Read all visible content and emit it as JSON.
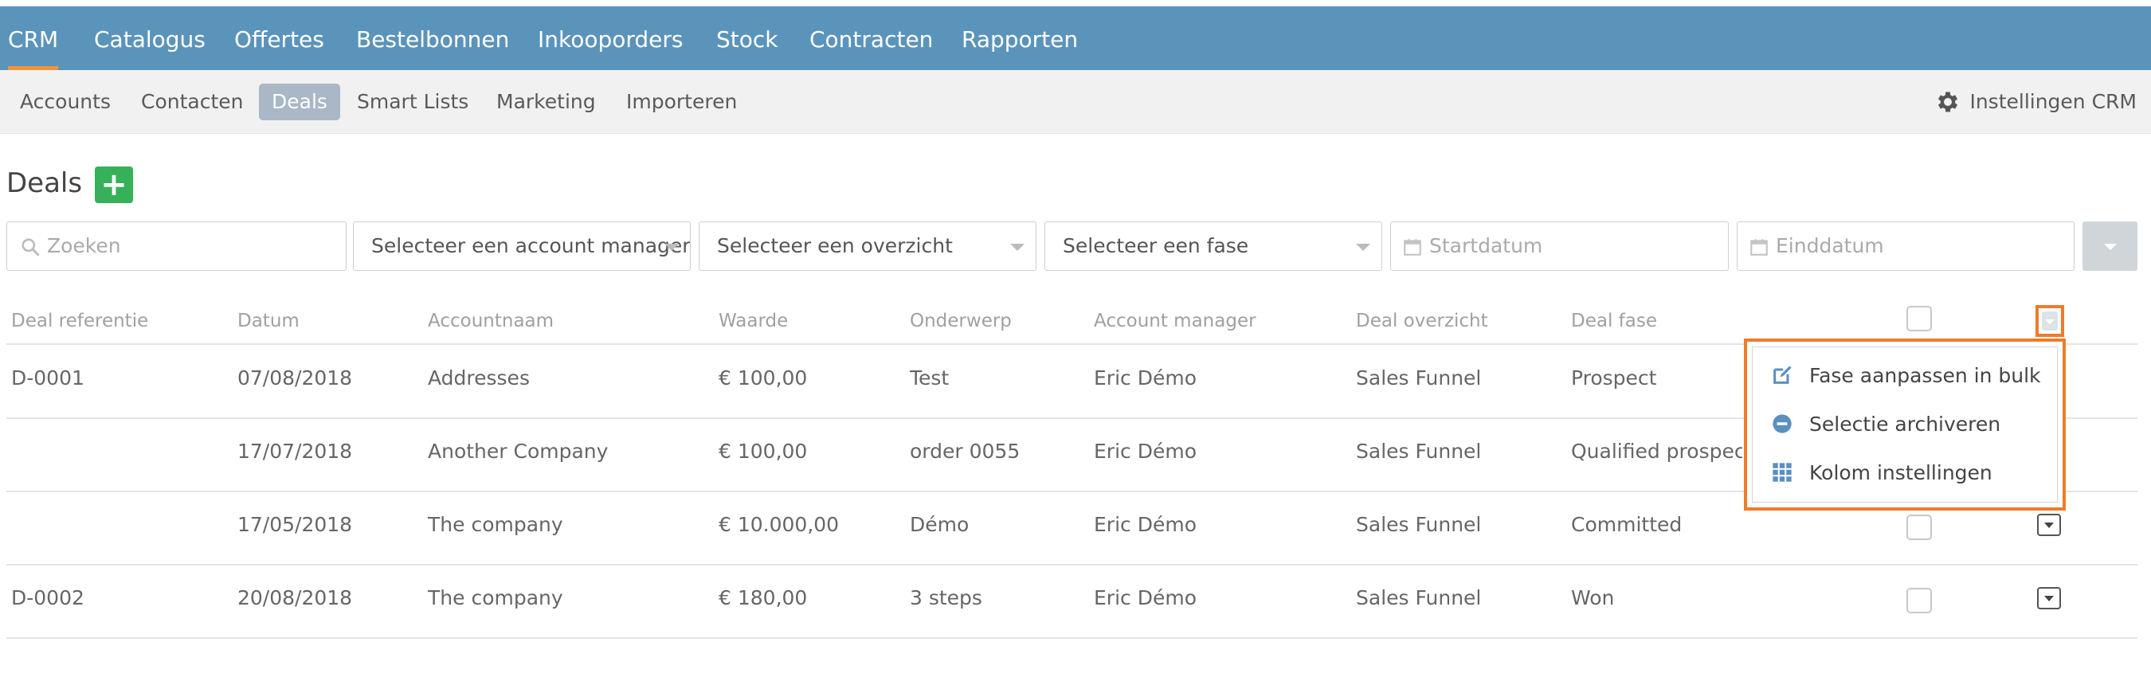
{
  "top_nav": [
    "CRM",
    "Catalogus",
    "Offertes",
    "Bestelbonnen",
    "Inkooporders",
    "Stock",
    "Contracten",
    "Rapporten"
  ],
  "sub_nav": [
    "Accounts",
    "Contacten",
    "Deals",
    "Smart Lists",
    "Marketing",
    "Importeren"
  ],
  "settings_label": "Instellingen CRM",
  "page_title": "Deals",
  "filters": {
    "search_placeholder": "Zoeken",
    "account_manager": "Selecteer een account manager",
    "overview": "Selecteer een overzicht",
    "phase": "Selecteer een fase",
    "start_date_placeholder": "Startdatum",
    "end_date_placeholder": "Einddatum"
  },
  "table": {
    "columns": [
      "Deal referentie",
      "Datum",
      "Accountnaam",
      "Waarde",
      "Onderwerp",
      "Account manager",
      "Deal overzicht",
      "Deal fase"
    ],
    "rows": [
      [
        "D-0001",
        "07/08/2018",
        "Addresses",
        "€ 100,00",
        "Test",
        "Eric Démo",
        "Sales Funnel",
        "Prospect"
      ],
      [
        "",
        "17/07/2018",
        "Another Company",
        "€ 100,00",
        "order 0055",
        "Eric Démo",
        "Sales Funnel",
        "Qualified prospect"
      ],
      [
        "",
        "17/05/2018",
        "The company",
        "€ 10.000,00",
        "Démo",
        "Eric Démo",
        "Sales Funnel",
        "Committed"
      ],
      [
        "D-0002",
        "20/08/2018",
        "The company",
        "€ 180,00",
        "3 steps",
        "Eric Démo",
        "Sales Funnel",
        "Won"
      ]
    ]
  },
  "bulk_menu": {
    "items": [
      {
        "label": "Fase aanpassen in bulk",
        "icon": "edit-icon"
      },
      {
        "label": "Selectie archiveren",
        "icon": "minus-circle-icon"
      },
      {
        "label": "Kolom instellingen",
        "icon": "grid-icon"
      }
    ]
  },
  "colors": {
    "top_bar": "#5b94bb",
    "active_underline": "#f0933a",
    "add_button": "#36b15a",
    "highlight_border": "#f07b2a",
    "menu_icon": "#5b8fc0"
  }
}
